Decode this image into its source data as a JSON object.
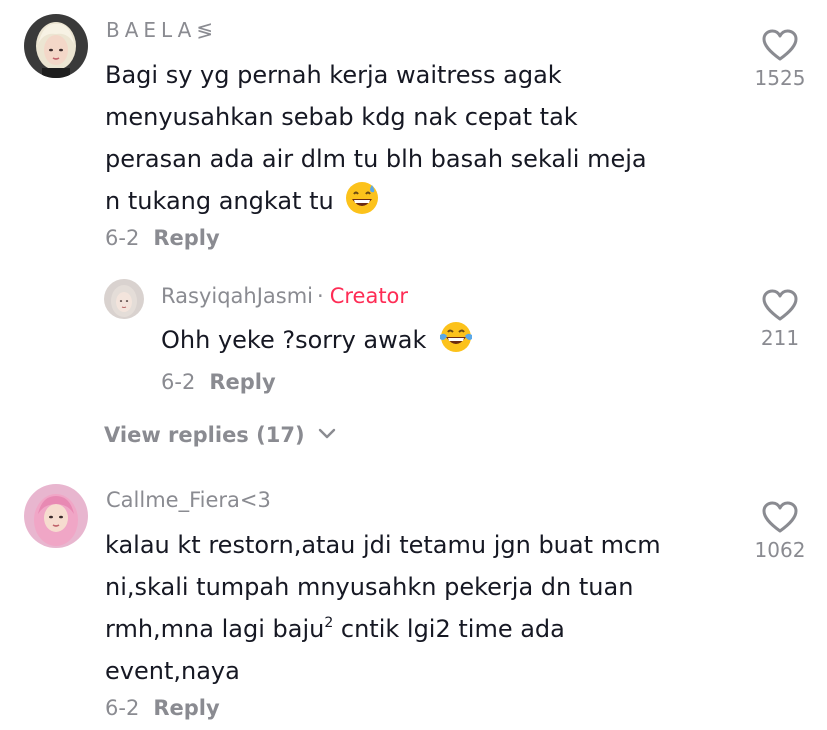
{
  "comments": [
    {
      "username": "BAELA",
      "username_suffix": "≶",
      "text": "Bagi sy yg pernah kerja waitress agak menyusahkan sebab kdg nak cepat tak perasan ada air dlm tu blh basah sekali meja n tukang angkat tu",
      "emoji": "grinning-sweat-emoji",
      "date": "6-2",
      "reply_label": "Reply",
      "like_count": "1525",
      "like_icon": "heart-outline-icon",
      "avatar_colors": {
        "bg": "#3a3a3a",
        "hair": "#f0ead8",
        "skin": "#f3d7c8"
      },
      "reply": {
        "username": "RasyiqahJasmi",
        "separator": "·",
        "badge": "Creator",
        "badge_color": "#fe2c55",
        "text": "Ohh yeke ?sorry awak",
        "emoji": "laughing-tears-emoji",
        "date": "6-2",
        "reply_label": "Reply",
        "like_count": "211",
        "avatar_colors": {
          "bg": "#d9d2cf",
          "hair": "#d8d0cb",
          "skin": "#f3e4dc"
        }
      },
      "view_replies": "View replies (17)"
    },
    {
      "username": "Callme_Fiera<3",
      "text_lines": [
        "kalau kt restorn,atau jdi tetamu jgn buat mcm",
        "ni,skali tumpah mnyusahkn pekerja dn tuan",
        "rmh,mna lagi baju",
        "cntik lgi2 time ada",
        "event,naya"
      ],
      "superscript": "2",
      "date": "6-2",
      "reply_label": "Reply",
      "like_count": "1062",
      "avatar_colors": {
        "bg": "#e8b6cf",
        "hijab": "#f0a6c6",
        "skin": "#f6dccf"
      }
    }
  ],
  "colors": {
    "text_primary": "#161823",
    "text_secondary": "#8a8b91",
    "creator": "#fe2c55"
  }
}
